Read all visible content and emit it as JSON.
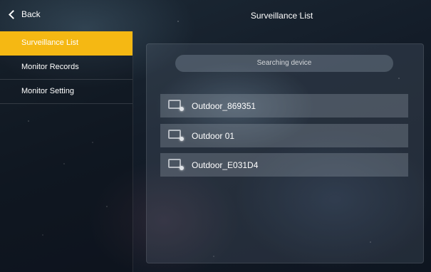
{
  "header": {
    "back_label": "Back",
    "title": "Surveillance List"
  },
  "sidebar": {
    "items": [
      {
        "label": "Surveillance List",
        "active": true
      },
      {
        "label": "Monitor Records",
        "active": false
      },
      {
        "label": "Monitor Setting",
        "active": false
      }
    ]
  },
  "panel": {
    "status_text": "Searching device",
    "devices": [
      {
        "name": "Outdoor_869351",
        "icon": "monitor-icon"
      },
      {
        "name": "Outdoor 01",
        "icon": "monitor-icon"
      },
      {
        "name": "Outdoor_E031D4",
        "icon": "monitor-icon"
      }
    ]
  },
  "colors": {
    "accent": "#f5b813"
  }
}
